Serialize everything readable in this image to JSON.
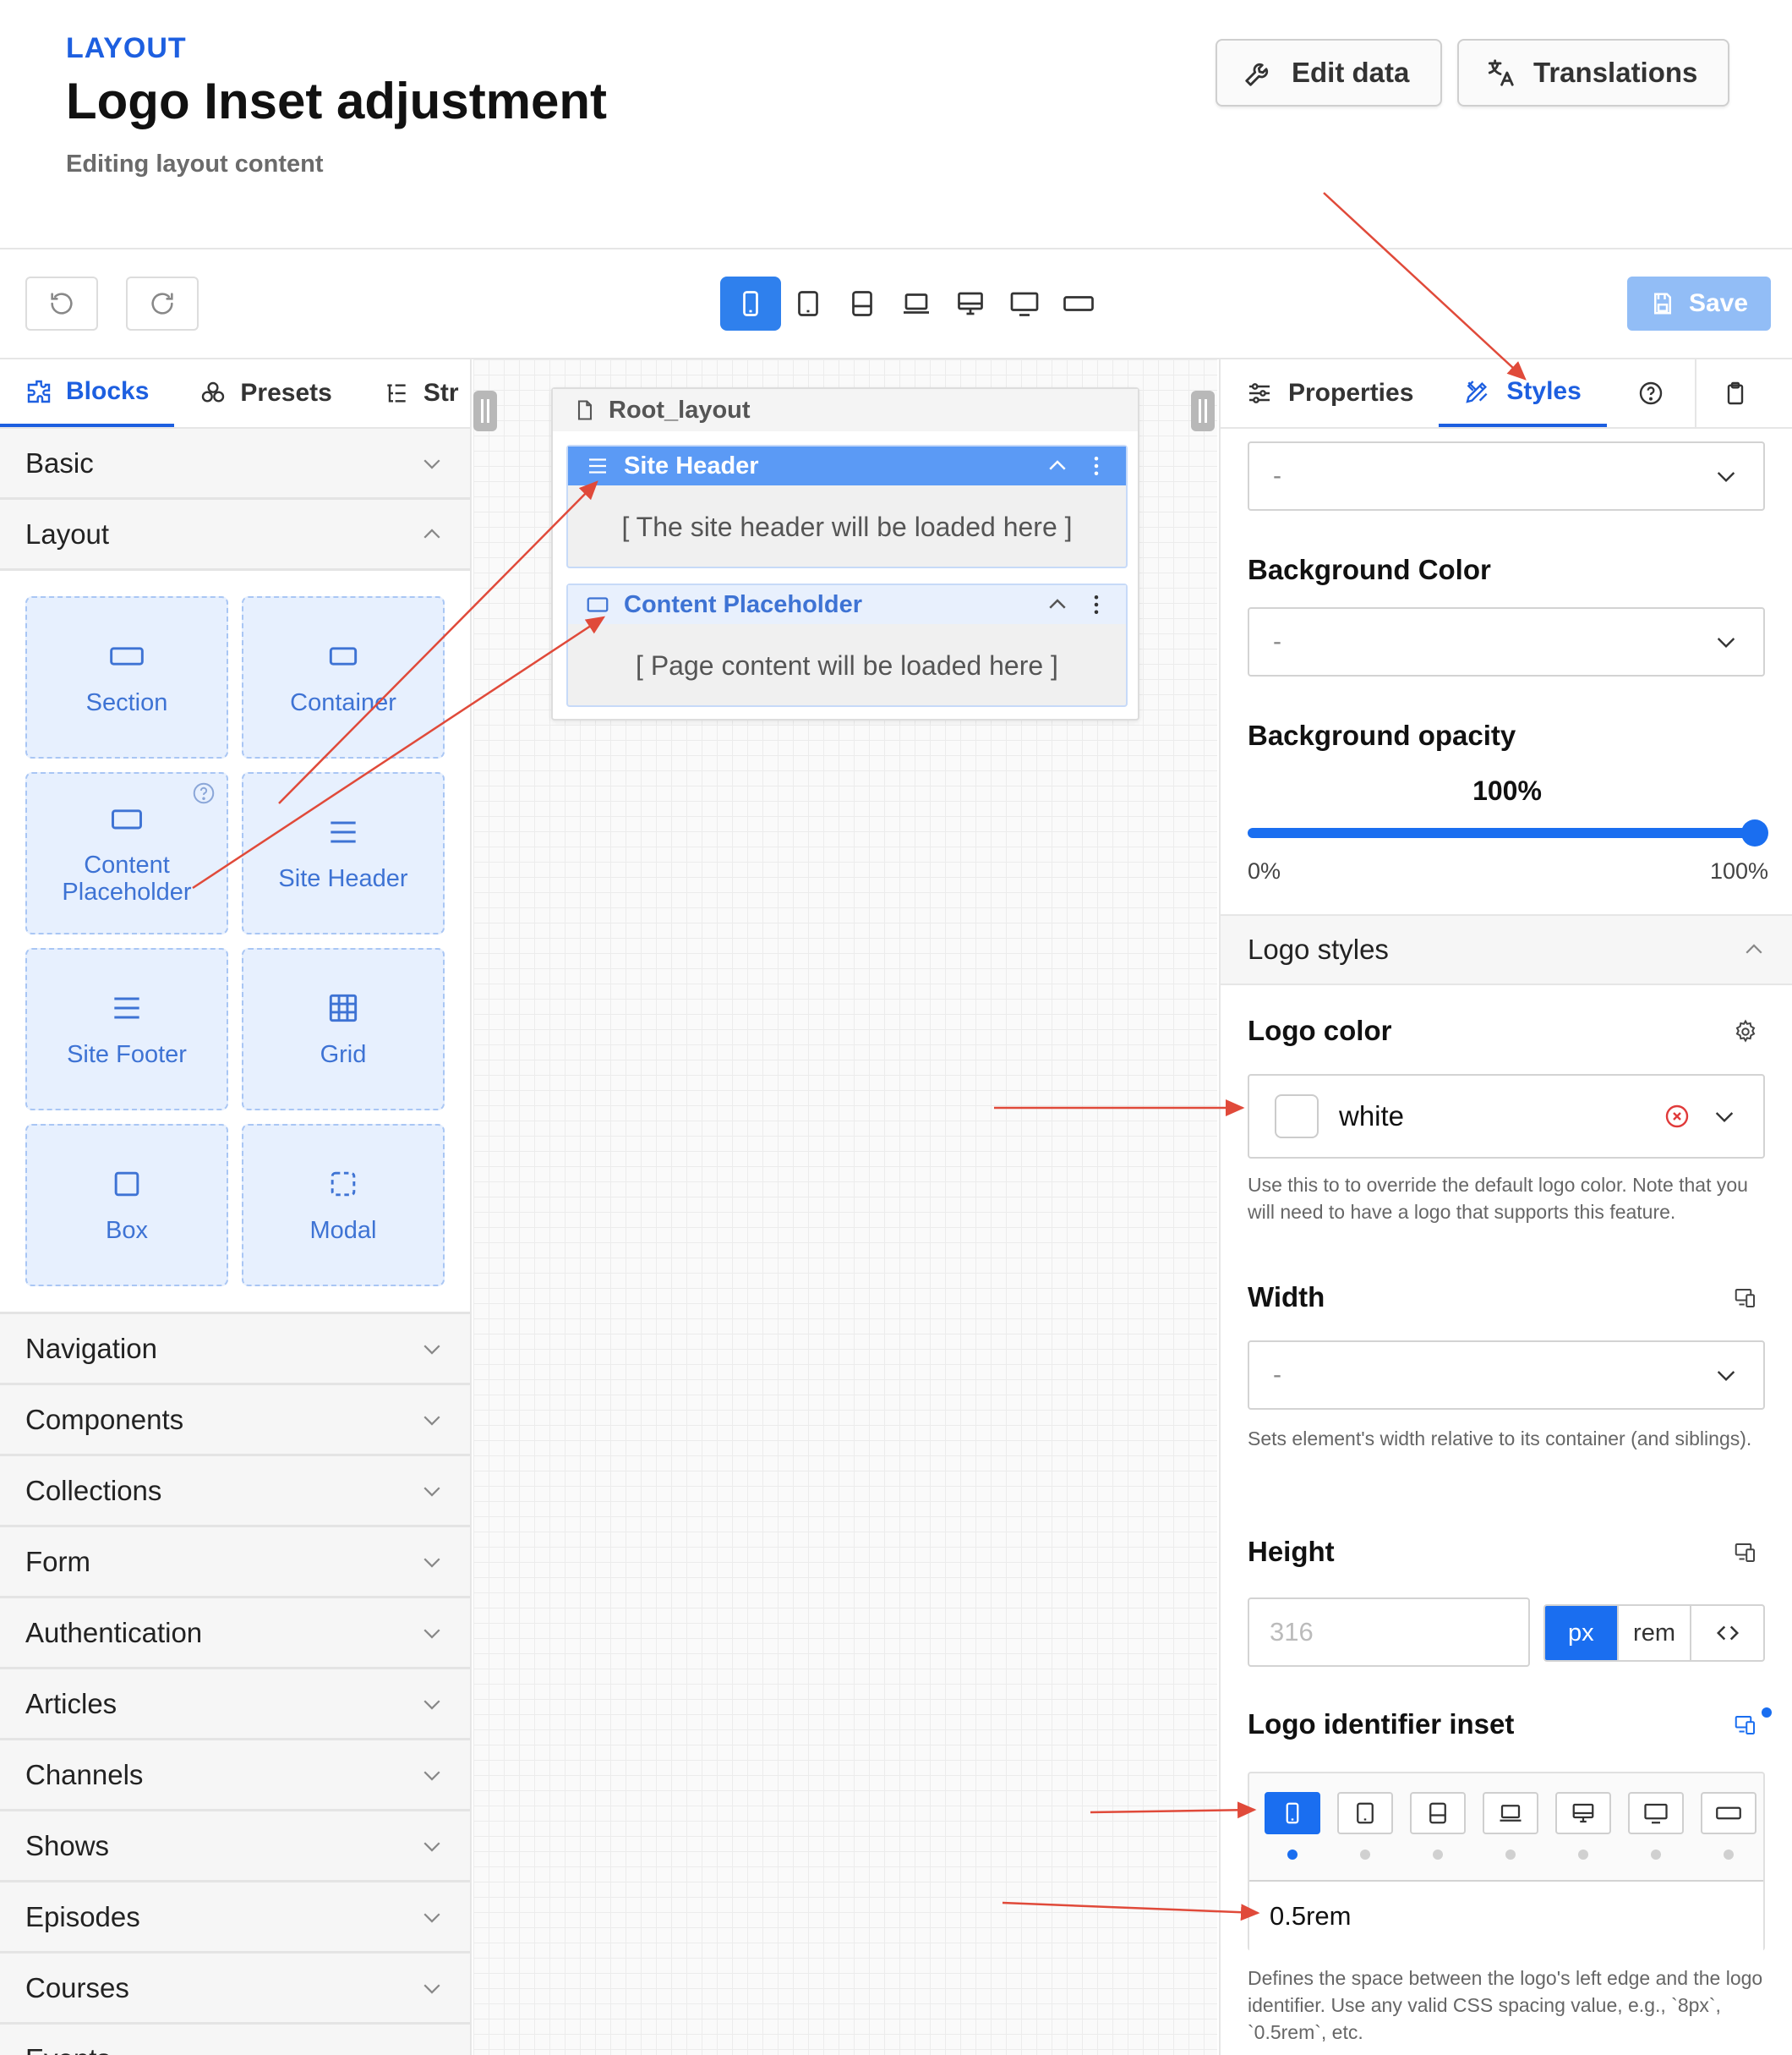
{
  "header": {
    "eyebrow": "LAYOUT",
    "title": "Logo Inset adjustment",
    "subtitle": "Editing layout content",
    "edit_data_label": "Edit data",
    "translations_label": "Translations"
  },
  "toolbar": {
    "save_label": "Save",
    "devices": [
      "mobile",
      "tablet-portrait",
      "tablet-landscape",
      "laptop",
      "desktop",
      "monitor",
      "wide"
    ],
    "active_device": "mobile"
  },
  "left": {
    "tabs": [
      {
        "label": "Blocks",
        "icon": "puzzle-icon",
        "active": true
      },
      {
        "label": "Presets",
        "icon": "shapes-icon",
        "active": false
      },
      {
        "label": "Str",
        "icon": "tree-icon",
        "active": false
      }
    ],
    "basic_label": "Basic",
    "layout_label": "Layout",
    "blocks": [
      {
        "label": "Section",
        "icon": "section-icon"
      },
      {
        "label": "Container",
        "icon": "container-icon"
      },
      {
        "label": "Content Placeholder",
        "icon": "placeholder-icon",
        "help": true
      },
      {
        "label": "Site Header",
        "icon": "menu-icon"
      },
      {
        "label": "Site Footer",
        "icon": "menu-icon"
      },
      {
        "label": "Grid",
        "icon": "grid-icon"
      },
      {
        "label": "Box",
        "icon": "box-icon"
      },
      {
        "label": "Modal",
        "icon": "modal-icon"
      }
    ],
    "categories": [
      "Navigation",
      "Components",
      "Collections",
      "Form",
      "Authentication",
      "Articles",
      "Channels",
      "Shows",
      "Episodes",
      "Courses",
      "Events"
    ]
  },
  "canvas": {
    "root_label": "Root_layout",
    "site_header_label": "Site Header",
    "site_header_placeholder": "[ The site header will be loaded here ]",
    "content_placeholder_label": "Content Placeholder",
    "content_placeholder_text": "[ Page content will be loaded here ]"
  },
  "right": {
    "tabs": {
      "properties": "Properties",
      "styles": "Styles"
    },
    "top_select_value": "-",
    "bg_color_label": "Background Color",
    "bg_color_value": "-",
    "bg_opacity_label": "Background opacity",
    "bg_opacity_value": "100%",
    "bg_opacity_fraction": 1.0,
    "slider_min": "0%",
    "slider_max": "100%",
    "logo_styles_label": "Logo styles",
    "logo_color_label": "Logo color",
    "logo_color_value": "white",
    "logo_color_help": "Use this to to override the default logo color. Note that you will need to have a logo that supports this feature.",
    "width_label": "Width",
    "width_value": "-",
    "width_help": "Sets element's width relative to its container (and siblings).",
    "height_label": "Height",
    "height_placeholder": "316",
    "units": [
      "px",
      "rem"
    ],
    "active_unit": "px",
    "inset_label": "Logo identifier inset",
    "inset_value": "0.5rem",
    "inset_help": "Defines the space between the logo's left edge and the logo identifier. Use any valid CSS spacing value, e.g., `8px`, `0.5rem`, etc."
  },
  "colors": {
    "accent": "#1d5fe0",
    "primary": "#1a6ef0",
    "block_bg": "#e7f0fe",
    "arrow": "#e04a3a"
  }
}
